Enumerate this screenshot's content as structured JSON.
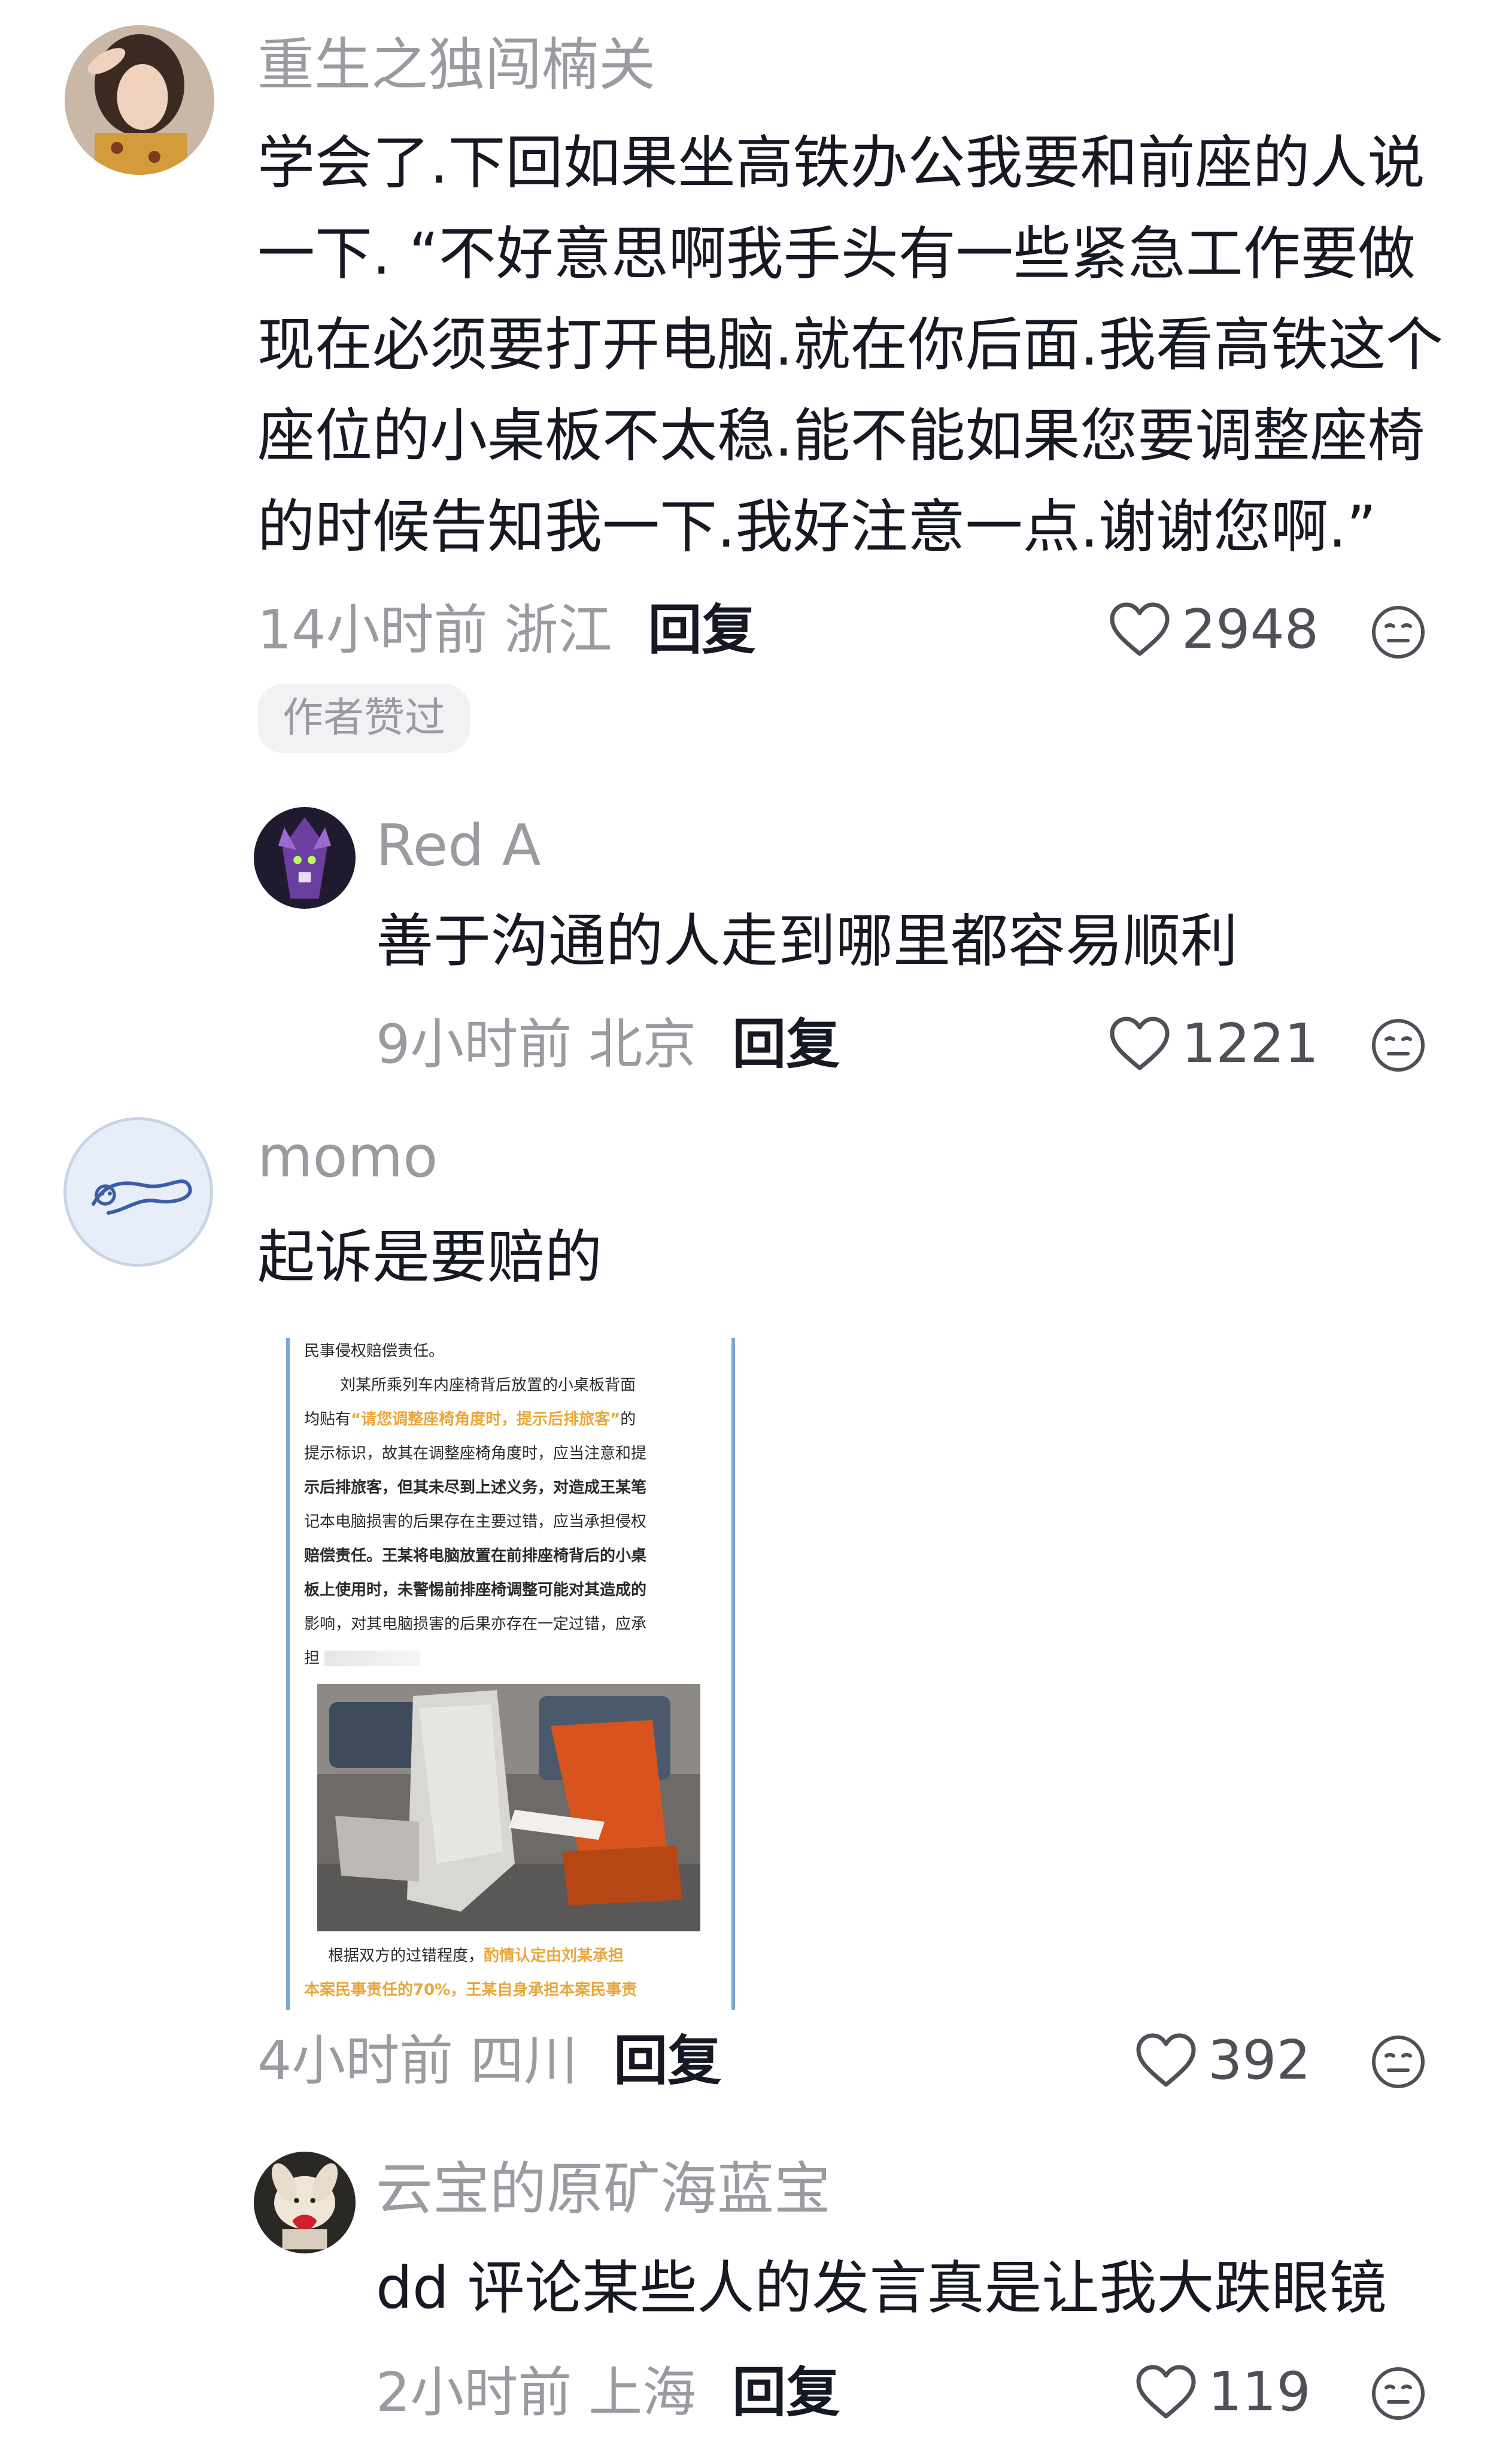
{
  "comments": [
    {
      "username": "重生之独闯楠关",
      "text": "学会了.下回如果坐高铁办公我要和前座的人说一下. “不好意思啊我手头有一些紧急工作要做现在必须要打开电脑.就在你后面.我看高铁这个座位的小桌板不太稳.能不能如果您要调整座椅的时候告知我一下.我好注意一点.谢谢您啊.”",
      "time": "14小时前",
      "region": "浙江",
      "reply_label": "回复",
      "likes": "2948",
      "badge": "作者赞过",
      "replies": [
        {
          "username": "Red A",
          "text": "善于沟通的人走到哪里都容易顺利",
          "time": "9小时前",
          "region": "北京",
          "reply_label": "回复",
          "likes": "1221"
        }
      ]
    },
    {
      "username": "momo",
      "text": "起诉是要赔的",
      "image": {
        "line1": "民事侵权赔偿责任。",
        "line2": "刘某所乘列车内座椅背后放置的小桌板背面",
        "line3_pre": "均贴有",
        "line3_hl": "“请您调整座椅角度时，提示后排旅客”",
        "line3_post": "的",
        "line4": "提示标识，故其在调整座椅角度时，应当注意和提",
        "line5": "示后排旅客，但其未尽到上述义务，对造成王某笔",
        "line6": "记本电脑损害的后果存在主要过错，应当承担侵权",
        "line7": "赔偿责任。王某将电脑放置在前排座椅背后的小桌",
        "line8": "板上使用时，未警惕前排座椅调整可能对其造成的",
        "line9": "影响，对其电脑损害的后果亦存在一定过错，应承",
        "line10": "担",
        "bottom1_pre": "根据双方的过错程度，",
        "bottom1_hl": "酌情认定由刘某承担",
        "bottom2_hl": "本案民事责任的70%，王某自身承担本案民事责"
      },
      "time": "4小时前",
      "region": "四川",
      "reply_label": "回复",
      "likes": "392",
      "replies": [
        {
          "username": "云宝的原矿海蓝宝",
          "text": "dd 评论某些人的发言真是让我大跌眼镜",
          "time": "2小时前",
          "region": "上海",
          "reply_label": "回复",
          "likes": "119"
        }
      ]
    }
  ],
  "icons": {
    "like": "heart-outline-icon",
    "dislike": "neutral-face-icon"
  }
}
